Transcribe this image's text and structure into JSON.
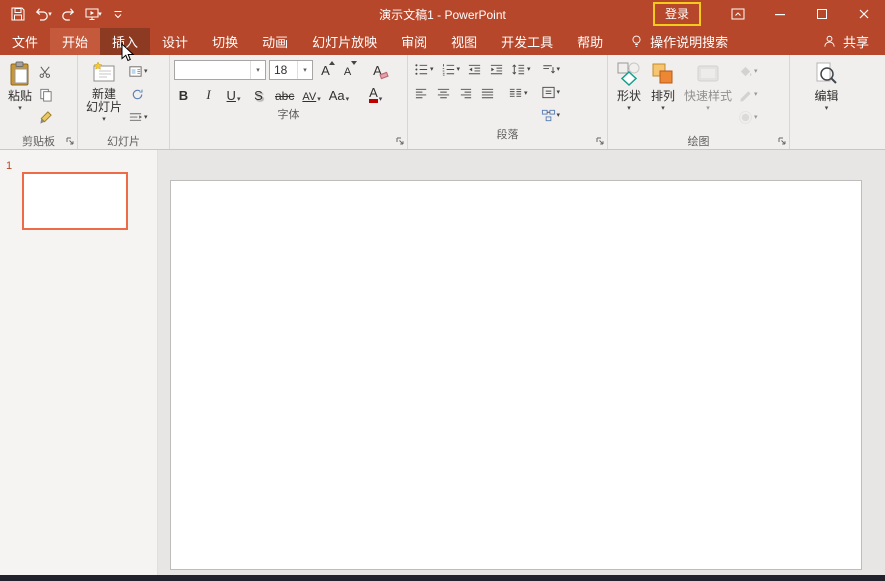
{
  "window": {
    "title": "演示文稿1 - PowerPoint",
    "login": "登录"
  },
  "tabs": {
    "file": "文件",
    "home": "开始",
    "insert": "插入",
    "design": "设计",
    "transitions": "切换",
    "animations": "动画",
    "slideshow": "幻灯片放映",
    "review": "审阅",
    "view": "视图",
    "developer": "开发工具",
    "help": "帮助",
    "tellme": "操作说明搜索",
    "share": "共享"
  },
  "ribbon": {
    "clipboard": {
      "group": "剪贴板",
      "paste": "粘贴"
    },
    "slides": {
      "group": "幻灯片",
      "new_slide_1": "新建",
      "new_slide_2": "幻灯片"
    },
    "font": {
      "group": "字体",
      "name": "",
      "size": "18",
      "bold": "B",
      "italic": "I",
      "underline": "U",
      "shadow": "S",
      "strikethrough": "abc",
      "spacing": "AV",
      "case": "Aa",
      "grow": "A",
      "shrink": "A",
      "clear": "A",
      "color": "A"
    },
    "paragraph": {
      "group": "段落"
    },
    "drawing": {
      "group": "绘图",
      "shapes": "形状",
      "arrange": "排列",
      "quick_styles": "快速样式"
    },
    "editing": {
      "label": "编辑"
    }
  },
  "slides_panel": {
    "slide_number": "1"
  },
  "colors": {
    "titlebar": "#B7472A",
    "tab_active": "#C4593C",
    "tab_pressed": "#8C3A22",
    "login_border": "#F2CB1D",
    "selected_slide_border": "#ED6C47",
    "font_color_bar": "#C00000",
    "ribbon_bg": "#F1EFED"
  },
  "icon_names": [
    "save-icon",
    "undo-icon",
    "redo-icon",
    "slideshow-icon",
    "qat-customize-icon",
    "bulb-icon",
    "person-icon",
    "ribbon-display-icon",
    "minimize-icon",
    "maximize-icon",
    "close-icon",
    "paste-icon",
    "cut-icon",
    "copy-icon",
    "format-painter-icon",
    "new-slide-icon",
    "layout-icon",
    "reset-icon",
    "section-icon",
    "grow-font-icon",
    "shrink-font-icon",
    "clear-format-icon",
    "bullets-icon",
    "numbering-icon",
    "indent-decrease-icon",
    "indent-increase-icon",
    "line-spacing-icon",
    "text-direction-icon",
    "align-text-icon",
    "smartart-icon",
    "align-left-icon",
    "align-center-icon",
    "align-right-icon",
    "justify-icon",
    "columns-icon",
    "shapes-icon",
    "arrange-icon",
    "quick-styles-icon",
    "shape-fill-icon",
    "shape-outline-icon",
    "shape-effects-icon",
    "search-icon",
    "dialog-launcher-icon",
    "mouse-cursor"
  ]
}
